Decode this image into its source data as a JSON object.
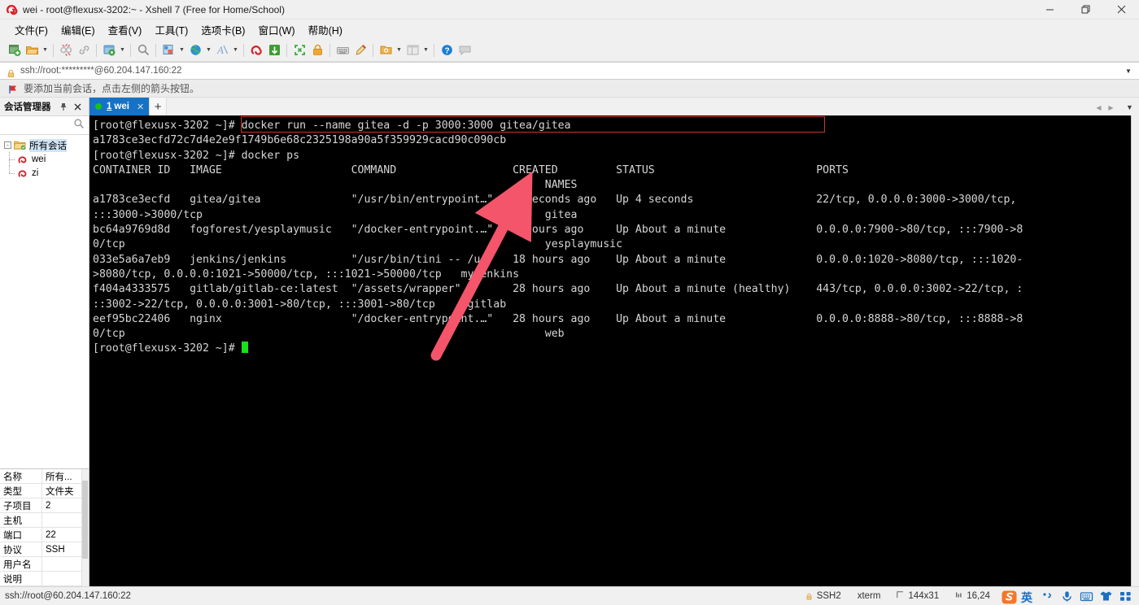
{
  "window": {
    "title": "wei - root@flexusx-3202:~ - Xshell 7 (Free for Home/School)",
    "minimize": "—",
    "maximize": "❐",
    "close": "✕"
  },
  "menubar": {
    "items": [
      {
        "label": "文件(F)",
        "name": "menu-file"
      },
      {
        "label": "编辑(E)",
        "name": "menu-edit"
      },
      {
        "label": "查看(V)",
        "name": "menu-view"
      },
      {
        "label": "工具(T)",
        "name": "menu-tools"
      },
      {
        "label": "选项卡(B)",
        "name": "menu-tabs"
      },
      {
        "label": "窗口(W)",
        "name": "menu-window"
      },
      {
        "label": "帮助(H)",
        "name": "menu-help"
      }
    ]
  },
  "toolbar": {
    "buttons": [
      "new-session-icon",
      "open-folder-icon",
      "caret-down",
      "sep",
      "disconnect-icon",
      "link-icon",
      "sep",
      "properties-icon",
      "caret-down",
      "sep",
      "find-icon",
      "sep",
      "layout-icon",
      "caret-down",
      "globe-icon",
      "caret-down",
      "font-icon",
      "caret-down",
      "sep",
      "xshell-icon",
      "xftp-icon",
      "sep",
      "fullscreen-icon",
      "lock-icon",
      "sep",
      "keyboard-icon",
      "highlight-icon",
      "sep",
      "folder-star-icon",
      "caret-down",
      "panes-icon",
      "caret-down",
      "sep",
      "help-icon",
      "comment-icon"
    ]
  },
  "address": {
    "value": "ssh://root:*********@60.204.147.160:22",
    "lock_icon": "lock-icon",
    "dropdown_icon": "chevron-down-icon"
  },
  "notice": {
    "icon": "red-flag-icon",
    "text": "要添加当前会话，点击左侧的箭头按钮。"
  },
  "sidebar": {
    "title": "会话管理器",
    "pin_icon": "pin-icon",
    "close_icon": "close-icon",
    "search_icon": "search-icon",
    "tree": {
      "root": {
        "label": "所有会话",
        "expander": "-",
        "icon": "folder-icon",
        "selected": true
      },
      "children": [
        {
          "label": "wei",
          "icon": "session-icon"
        },
        {
          "label": "zi",
          "icon": "session-icon"
        }
      ]
    },
    "properties": [
      {
        "key": "名称",
        "value": "所有..."
      },
      {
        "key": "类型",
        "value": "文件夹"
      },
      {
        "key": "子项目",
        "value": "2"
      },
      {
        "key": "主机",
        "value": ""
      },
      {
        "key": "端口",
        "value": "22"
      },
      {
        "key": "协议",
        "value": "SSH"
      },
      {
        "key": "用户名",
        "value": ""
      },
      {
        "key": "说明",
        "value": ""
      }
    ]
  },
  "tabs": {
    "items": [
      {
        "number": "1",
        "label": "wei",
        "active": true,
        "status_dot": "#19c119",
        "close_icon": "close-icon"
      }
    ],
    "new_tab_label": "+",
    "nav_prev": "◀",
    "nav_next": "▶",
    "nav_list": "▼"
  },
  "terminal": {
    "highlight_color": "#c0392b",
    "arrow_color": "#f4556a",
    "lines": [
      "[root@flexusx-3202 ~]# docker run --name gitea -d -p 3000:3000 gitea/gitea",
      "a1783ce3ecfd72c7d4e2e9f1749b6e68c2325198a90a5f359929cacd90c090cb",
      "[root@flexusx-3202 ~]# docker ps",
      "CONTAINER ID   IMAGE                    COMMAND                  CREATED         STATUS                         PORTS                                                                                      NAMES",
      "a1783ce3ecfd   gitea/gitea              \"/usr/bin/entrypoint…\"   4 seconds ago   Up 4 seconds                   22/tcp, 0.0.0.0:3000->3000/tcp, :::3000->3000/tcp                                          gitea",
      "bc64a9769d8d   fogforest/yesplaymusic   \"/docker-entrypoint.…\"   5 hours ago     Up About a minute              0.0.0.0:7900->80/tcp, :::7900->80/tcp                                                      yesplaymusic",
      "033e5a6a7eb9   jenkins/jenkins          \"/usr/bin/tini -- /u…\"   18 hours ago    Up About a minute              0.0.0.0:1020->8080/tcp, :::1020->8080/tcp, 0.0.0.0:1021->50000/tcp, :::1021->50000/tcp      myjenkins",
      "f404a4333575   gitlab/gitlab-ce:latest  \"/assets/wrapper\"        28 hours ago    Up About a minute (healthy)    443/tcp, 0.0.0.0:3002->22/tcp, :::3002->22/tcp, 0.0.0.0:3001->80/tcp, :::3001->80/tcp      gitlab",
      "eef95bc22406   nginx                    \"/docker-entrypoint.…\"   28 hours ago    Up About a minute              0.0.0.0:8888->80/tcp, :::8888->80/tcp                                                      web",
      "[root@flexusx-3202 ~]# "
    ],
    "rendered": {
      "l1": "[root@flexusx-3202 ~]# docker run --name gitea -d -p 3000:3000 gitea/gitea",
      "l2": "a1783ce3ecfd72c7d4e2e9f1749b6e68c2325198a90a5f359929cacd90c090cb",
      "l3": "[root@flexusx-3202 ~]# docker ps",
      "l4": "CONTAINER ID   IMAGE                    COMMAND                  CREATED         STATUS                         PORTS",
      "l5": "                                                                      NAMES",
      "l6": "a1783ce3ecfd   gitea/gitea              \"/usr/bin/entrypoint…\"   4 seconds ago   Up 4 seconds                   22/tcp, 0.0.0.0:3000->3000/tcp,",
      "l7": ":::3000->3000/tcp                                                     gitea",
      "l8": "bc64a9769d8d   fogforest/yesplaymusic   \"/docker-entrypoint.…\"   5 hours ago     Up About a minute              0.0.0.0:7900->80/tcp, :::7900->8",
      "l9": "0/tcp                                                                 yesplaymusic",
      "l10": "033e5a6a7eb9   jenkins/jenkins          \"/usr/bin/tini -- /u…\"   18 hours ago    Up About a minute              0.0.0.0:1020->8080/tcp, :::1020-",
      "l11": ">8080/tcp, 0.0.0.0:1021->50000/tcp, :::1021->50000/tcp   myjenkins",
      "l12": "f404a4333575   gitlab/gitlab-ce:latest  \"/assets/wrapper\"        28 hours ago    Up About a minute (healthy)    443/tcp, 0.0.0.0:3002->22/tcp, :",
      "l13": "::3002->22/tcp, 0.0.0.0:3001->80/tcp, :::3001->80/tcp     gitlab",
      "l14": "eef95bc22406   nginx                    \"/docker-entrypoint.…\"   28 hours ago    Up About a minute              0.0.0.0:8888->80/tcp, :::8888->8",
      "l15": "0/tcp                                                                 web",
      "l16": "[root@flexusx-3202 ~]# "
    }
  },
  "statusbar": {
    "connection": "ssh://root@60.204.147.160:22",
    "protocol": "SSH2",
    "term_type": "xterm",
    "size": "144x31",
    "cursor_pos": "16,24",
    "size_icon": "terminal-size-icon",
    "cursor_icon": "cursor-pos-icon",
    "lock_icon": "lock-icon",
    "tray": [
      {
        "name": "sogou-ime-icon",
        "glyph": "S"
      },
      {
        "name": "ime-language-icon",
        "glyph": "英"
      },
      {
        "name": "ime-punctuation-icon",
        "glyph": "·,"
      },
      {
        "name": "microphone-icon",
        "glyph": "\u0001"
      },
      {
        "name": "soft-keyboard-icon",
        "glyph": "⌨"
      },
      {
        "name": "ime-skin-icon",
        "glyph": "\u0002"
      },
      {
        "name": "ime-toolbox-icon",
        "glyph": "∷"
      }
    ]
  }
}
